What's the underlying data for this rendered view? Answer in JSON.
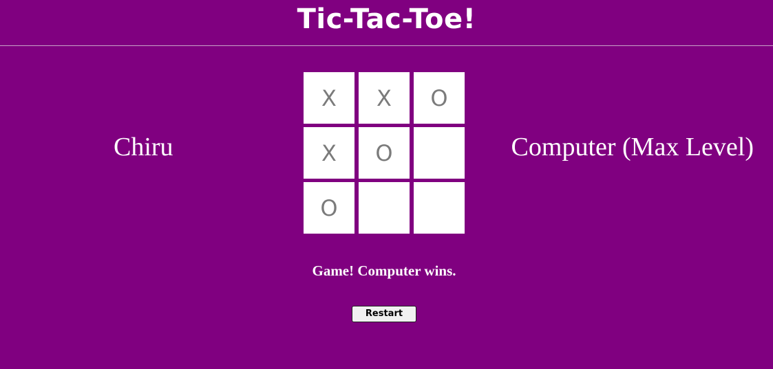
{
  "header": {
    "title": "Tic-Tac-Toe!"
  },
  "players": {
    "left": "Chiru",
    "right": "Computer (Max Level)"
  },
  "board": {
    "cells": [
      "X",
      "X",
      "O",
      "X",
      "O",
      "",
      "O",
      "",
      ""
    ]
  },
  "status": "Game! Computer wins.",
  "controls": {
    "restart_label": "Restart"
  },
  "colors": {
    "background": "#800080",
    "cell_background": "#ffffff",
    "mark": "#7b7b7b",
    "text": "#ffffff"
  }
}
